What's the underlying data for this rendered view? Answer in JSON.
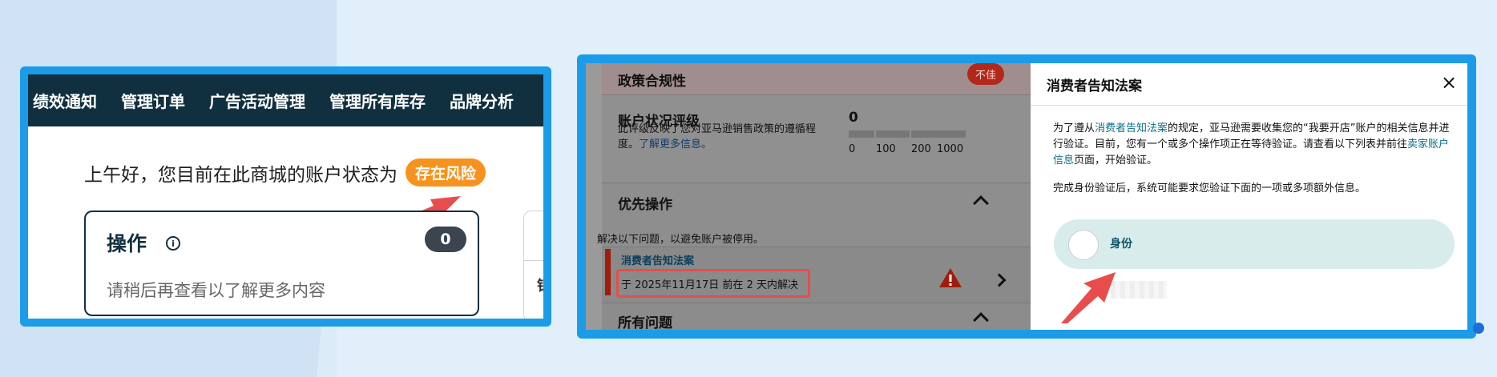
{
  "left_panel": {
    "nav": [
      "绩效通知",
      "管理订单",
      "广告活动管理",
      "管理所有库存",
      "品牌分析"
    ],
    "greeting": "上午好，您目前在此商城的账户状态为",
    "risk_badge": "存在风险",
    "ops_card": {
      "title": "操作",
      "info_icon": "i",
      "count": "0",
      "description": "请稍后再查看以了解更多内容"
    },
    "side_card_text": "银"
  },
  "right_panel": {
    "policy": {
      "title": "政策合规性",
      "badge": "不佳"
    },
    "account_health": {
      "title": "账户状况评级",
      "description": "此评级反映了您对亚马逊销售政策的遵循程度。",
      "link": "了解更多信息。",
      "score": "0",
      "scale_labels": [
        "0",
        "100",
        "200",
        "1000"
      ]
    },
    "priority": {
      "title": "优先操作",
      "subtitle": "解决以下问题，以避免账户被停用。"
    },
    "consumer_item": {
      "title": "消费者告知法案",
      "deadline": "于 2025年11月17日 前在 2 天内解决"
    },
    "all_issues": {
      "title": "所有问题"
    },
    "drawer": {
      "title": "消费者告知法案",
      "close": "×",
      "p1_a": "为了遵从",
      "p1_link1": "消费者告知法案",
      "p1_b": "的规定，亚马逊需要收集您的“我要开店”账户的相关信息并进行验证。目前，您有一个或多个操作项正在等待验证。请查看以下列表并前往",
      "p1_link2": "卖家账户信息",
      "p1_c": "页面，开始验证。",
      "p2": "完成身份验证后，系统可能要求您验证下面的一项或多项额外信息。",
      "identity_label": "身份"
    }
  },
  "colors": {
    "frame": "#1c9be8",
    "navbar": "#11303f",
    "risk": "#f6931e",
    "arrow": "#e84c4c"
  }
}
